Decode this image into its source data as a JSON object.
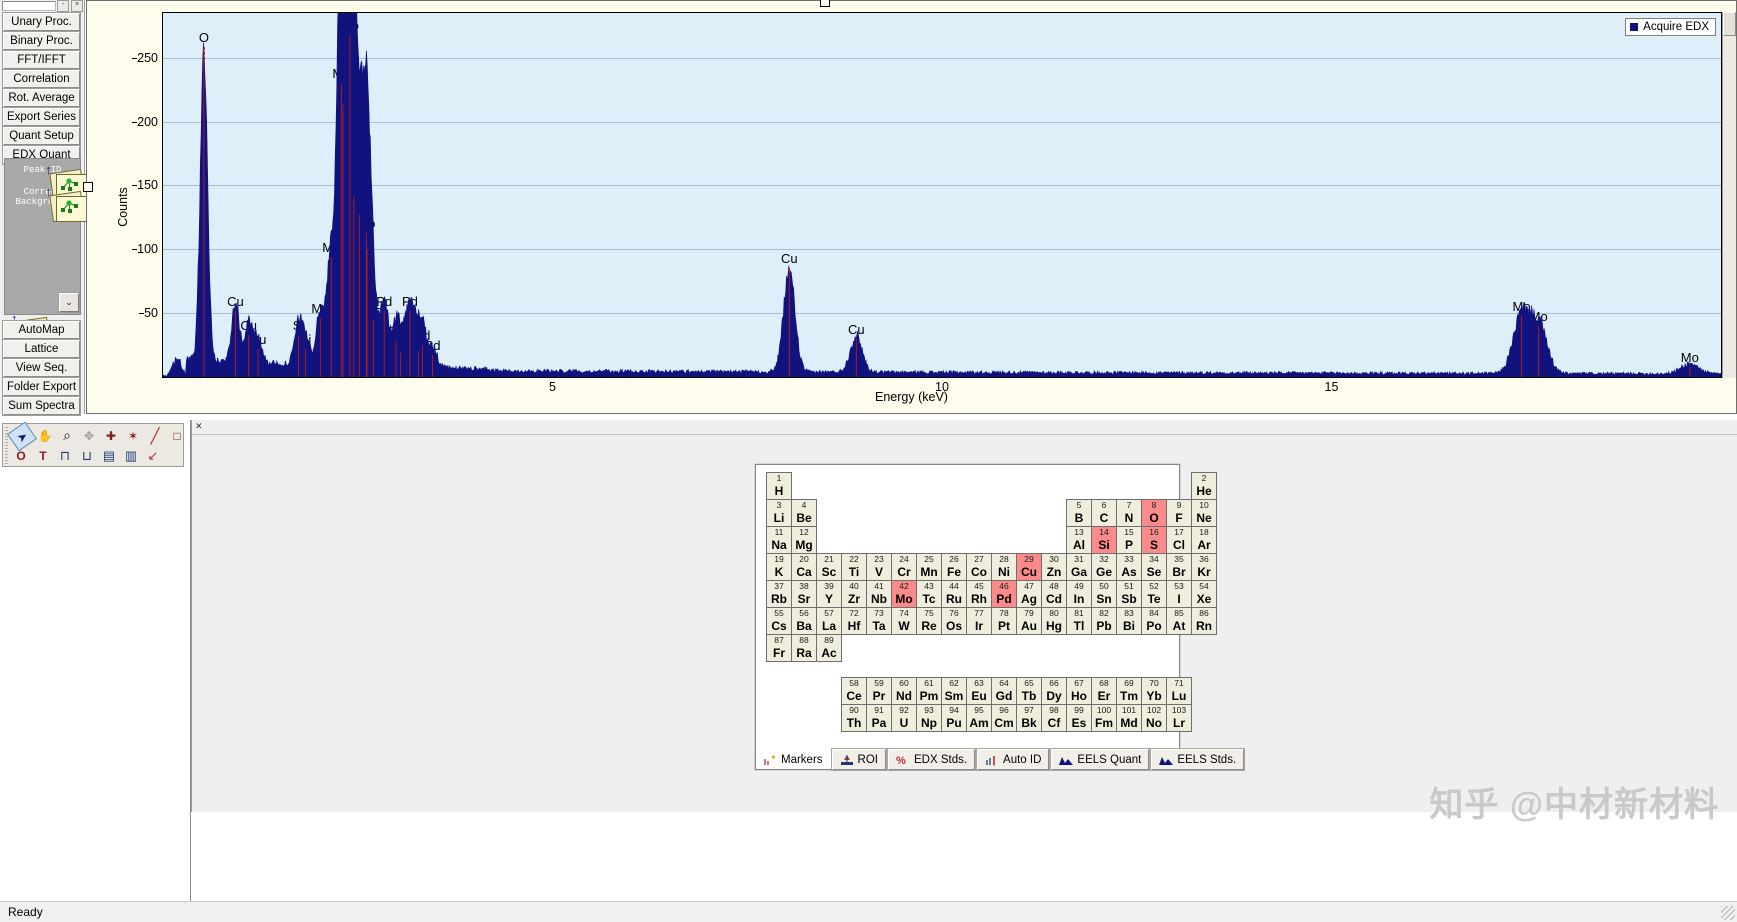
{
  "app": {
    "status_text": "Ready"
  },
  "palette": {
    "title_buttons": [
      "-",
      "×"
    ],
    "buttons_top": [
      {
        "label": "Unary Proc."
      },
      {
        "label": "Binary Proc."
      },
      {
        "label": "FFT/IFFT"
      },
      {
        "label": "Correlation"
      },
      {
        "label": "Rot. Average"
      },
      {
        "label": "Export Series"
      },
      {
        "label": "Quant Setup"
      },
      {
        "label": "EDX Quant"
      }
    ],
    "icon_buttons": [
      {
        "label": "Peak ID",
        "icon": "peak-id-icon"
      },
      {
        "label": "Correct Background",
        "icon": "correct-background-icon"
      }
    ],
    "dropdown_caret": "⌄",
    "buttons_bottom": [
      {
        "label": "AutoMap"
      },
      {
        "label": "Lattice"
      },
      {
        "label": "View Seq."
      },
      {
        "label": "Folder Export"
      },
      {
        "label": "Sum Spectra"
      }
    ]
  },
  "toolbar": {
    "row1": [
      {
        "name": "arrow-select-icon",
        "glyph": "➤"
      },
      {
        "name": "hand-pan-icon",
        "glyph": "✋"
      },
      {
        "name": "magnifier-zoom-icon",
        "glyph": "⌕"
      },
      {
        "name": "move-crosshair-icon",
        "glyph": "✥"
      },
      {
        "name": "marker-cross-icon",
        "glyph": "✚"
      },
      {
        "name": "point-marker-icon",
        "glyph": "✶"
      },
      {
        "name": "line-tool-icon",
        "glyph": "╱"
      },
      {
        "name": "rectangle-tool-icon",
        "glyph": "□"
      }
    ],
    "row2": [
      {
        "name": "oval-tool-icon",
        "glyph": "O"
      },
      {
        "name": "text-tool-icon",
        "glyph": "T"
      },
      {
        "name": "spectrum-picker-icon",
        "glyph": "⊓"
      },
      {
        "name": "spectrum-range-icon",
        "glyph": "⊔"
      },
      {
        "name": "ruler-tool-icon",
        "glyph": "▤"
      },
      {
        "name": "ruler-measure-icon",
        "glyph": "▥"
      },
      {
        "name": "annotation-tool-icon",
        "glyph": "↙"
      }
    ]
  },
  "chart_data": {
    "type": "line",
    "title": "",
    "xlabel": "Energy (keV)",
    "ylabel": "Counts",
    "xlim": [
      0,
      20
    ],
    "ylim": [
      0,
      285
    ],
    "xticks": [
      5,
      10,
      15
    ],
    "yticks": [
      50,
      100,
      150,
      200,
      250
    ],
    "grid": true,
    "legend_position": "top-right",
    "series": [
      {
        "name": "Acquire EDX",
        "color": "#12127e"
      }
    ],
    "peak_markers": [
      {
        "element": "O",
        "energy": 0.525,
        "counts": 258
      },
      {
        "element": "Cu",
        "energy": 0.93,
        "counts": 52
      },
      {
        "element": "Cu",
        "energy": 1.1,
        "counts": 33
      },
      {
        "element": "Cu",
        "energy": 1.22,
        "counts": 22
      },
      {
        "element": "Si",
        "energy": 1.74,
        "counts": 33
      },
      {
        "element": "Si",
        "energy": 1.83,
        "counts": 22
      },
      {
        "element": "Mo",
        "energy": 2.02,
        "counts": 46
      },
      {
        "element": "Mo",
        "energy": 2.16,
        "counts": 94
      },
      {
        "element": "S",
        "energy": 2.31,
        "counts": 214
      },
      {
        "element": "Mo",
        "energy": 2.29,
        "counts": 230
      },
      {
        "element": "Mo",
        "energy": 2.4,
        "counts": 268
      },
      {
        "element": "Pd",
        "energy": 2.45,
        "counts": 141
      },
      {
        "element": "Mo",
        "energy": 2.52,
        "counts": 127
      },
      {
        "element": "Mo",
        "energy": 2.61,
        "counts": 113
      },
      {
        "element": "S",
        "energy": 2.62,
        "counts": 100
      },
      {
        "element": "Mo",
        "energy": 2.7,
        "counts": 45
      },
      {
        "element": "Pd",
        "energy": 2.84,
        "counts": 52
      },
      {
        "element": "Pd",
        "energy": 2.99,
        "counts": 28
      },
      {
        "element": "Pd",
        "energy": 3.17,
        "counts": 52
      },
      {
        "element": "Pd",
        "energy": 3.05,
        "counts": 19
      },
      {
        "element": "Pd",
        "energy": 3.28,
        "counts": 20
      },
      {
        "element": "Pd",
        "energy": 3.33,
        "counts": 25
      },
      {
        "element": "Pd",
        "energy": 3.46,
        "counts": 17
      },
      {
        "element": "Cu",
        "energy": 8.04,
        "counts": 85
      },
      {
        "element": "Cu",
        "energy": 8.9,
        "counts": 30
      },
      {
        "element": "Mo",
        "energy": 17.44,
        "counts": 48
      },
      {
        "element": "Mo",
        "energy": 17.66,
        "counts": 40
      },
      {
        "element": "Mo",
        "energy": 19.6,
        "counts": 8
      }
    ]
  },
  "legend": {
    "label": "Acquire EDX",
    "color": "#12127e"
  },
  "periodic_table": {
    "selected": [
      "O",
      "Si",
      "Cu",
      "Mo",
      "Pd"
    ],
    "rows": [
      [
        {
          "n": "1",
          "s": "H",
          "c": 1
        },
        {
          "n": "2",
          "s": "He",
          "c": 18
        }
      ],
      [
        {
          "n": "3",
          "s": "Li",
          "c": 1
        },
        {
          "n": "4",
          "s": "Be",
          "c": 2
        },
        {
          "n": "5",
          "s": "B",
          "c": 13
        },
        {
          "n": "6",
          "s": "C",
          "c": 14
        },
        {
          "n": "7",
          "s": "N",
          "c": 15
        },
        {
          "n": "8",
          "s": "O",
          "c": 16,
          "hl": true
        },
        {
          "n": "9",
          "s": "F",
          "c": 17
        },
        {
          "n": "10",
          "s": "Ne",
          "c": 18
        }
      ],
      [
        {
          "n": "11",
          "s": "Na",
          "c": 1
        },
        {
          "n": "12",
          "s": "Mg",
          "c": 2
        },
        {
          "n": "13",
          "s": "Al",
          "c": 13
        },
        {
          "n": "14",
          "s": "Si",
          "c": 14,
          "hl": true
        },
        {
          "n": "15",
          "s": "P",
          "c": 15
        },
        {
          "n": "16",
          "s": "S",
          "c": 16,
          "hl": true
        },
        {
          "n": "17",
          "s": "Cl",
          "c": 17
        },
        {
          "n": "18",
          "s": "Ar",
          "c": 18
        }
      ],
      [
        {
          "n": "19",
          "s": "K",
          "c": 1
        },
        {
          "n": "20",
          "s": "Ca",
          "c": 2
        },
        {
          "n": "21",
          "s": "Sc",
          "c": 3
        },
        {
          "n": "22",
          "s": "Ti",
          "c": 4
        },
        {
          "n": "23",
          "s": "V",
          "c": 5
        },
        {
          "n": "24",
          "s": "Cr",
          "c": 6
        },
        {
          "n": "25",
          "s": "Mn",
          "c": 7
        },
        {
          "n": "26",
          "s": "Fe",
          "c": 8
        },
        {
          "n": "27",
          "s": "Co",
          "c": 9
        },
        {
          "n": "28",
          "s": "Ni",
          "c": 10
        },
        {
          "n": "29",
          "s": "Cu",
          "c": 11,
          "hl": true
        },
        {
          "n": "30",
          "s": "Zn",
          "c": 12
        },
        {
          "n": "31",
          "s": "Ga",
          "c": 13
        },
        {
          "n": "32",
          "s": "Ge",
          "c": 14
        },
        {
          "n": "33",
          "s": "As",
          "c": 15
        },
        {
          "n": "34",
          "s": "Se",
          "c": 16
        },
        {
          "n": "35",
          "s": "Br",
          "c": 17
        },
        {
          "n": "36",
          "s": "Kr",
          "c": 18
        }
      ],
      [
        {
          "n": "37",
          "s": "Rb",
          "c": 1
        },
        {
          "n": "38",
          "s": "Sr",
          "c": 2
        },
        {
          "n": "39",
          "s": "Y",
          "c": 3
        },
        {
          "n": "40",
          "s": "Zr",
          "c": 4
        },
        {
          "n": "41",
          "s": "Nb",
          "c": 5
        },
        {
          "n": "42",
          "s": "Mo",
          "c": 6,
          "hl": true
        },
        {
          "n": "43",
          "s": "Tc",
          "c": 7
        },
        {
          "n": "44",
          "s": "Ru",
          "c": 8
        },
        {
          "n": "45",
          "s": "Rh",
          "c": 9
        },
        {
          "n": "46",
          "s": "Pd",
          "c": 10,
          "hl": true
        },
        {
          "n": "47",
          "s": "Ag",
          "c": 11
        },
        {
          "n": "48",
          "s": "Cd",
          "c": 12
        },
        {
          "n": "49",
          "s": "In",
          "c": 13
        },
        {
          "n": "50",
          "s": "Sn",
          "c": 14
        },
        {
          "n": "51",
          "s": "Sb",
          "c": 15
        },
        {
          "n": "52",
          "s": "Te",
          "c": 16
        },
        {
          "n": "53",
          "s": "I",
          "c": 17
        },
        {
          "n": "54",
          "s": "Xe",
          "c": 18
        }
      ],
      [
        {
          "n": "55",
          "s": "Cs",
          "c": 1
        },
        {
          "n": "56",
          "s": "Ba",
          "c": 2
        },
        {
          "n": "57",
          "s": "La",
          "c": 3
        },
        {
          "n": "72",
          "s": "Hf",
          "c": 4
        },
        {
          "n": "73",
          "s": "Ta",
          "c": 5
        },
        {
          "n": "74",
          "s": "W",
          "c": 6
        },
        {
          "n": "75",
          "s": "Re",
          "c": 7
        },
        {
          "n": "76",
          "s": "Os",
          "c": 8
        },
        {
          "n": "77",
          "s": "Ir",
          "c": 9
        },
        {
          "n": "78",
          "s": "Pt",
          "c": 10
        },
        {
          "n": "79",
          "s": "Au",
          "c": 11
        },
        {
          "n": "80",
          "s": "Hg",
          "c": 12
        },
        {
          "n": "81",
          "s": "Tl",
          "c": 13
        },
        {
          "n": "82",
          "s": "Pb",
          "c": 14
        },
        {
          "n": "83",
          "s": "Bi",
          "c": 15
        },
        {
          "n": "84",
          "s": "Po",
          "c": 16
        },
        {
          "n": "85",
          "s": "At",
          "c": 17
        },
        {
          "n": "86",
          "s": "Rn",
          "c": 18
        }
      ],
      [
        {
          "n": "87",
          "s": "Fr",
          "c": 1
        },
        {
          "n": "88",
          "s": "Ra",
          "c": 2
        },
        {
          "n": "89",
          "s": "Ac",
          "c": 3
        }
      ]
    ],
    "lanthanides": [
      {
        "n": "58",
        "s": "Ce"
      },
      {
        "n": "59",
        "s": "Pr"
      },
      {
        "n": "60",
        "s": "Nd"
      },
      {
        "n": "61",
        "s": "Pm"
      },
      {
        "n": "62",
        "s": "Sm"
      },
      {
        "n": "63",
        "s": "Eu"
      },
      {
        "n": "64",
        "s": "Gd"
      },
      {
        "n": "65",
        "s": "Tb"
      },
      {
        "n": "66",
        "s": "Dy"
      },
      {
        "n": "67",
        "s": "Ho"
      },
      {
        "n": "68",
        "s": "Er"
      },
      {
        "n": "69",
        "s": "Tm"
      },
      {
        "n": "70",
        "s": "Yb"
      },
      {
        "n": "71",
        "s": "Lu"
      }
    ],
    "actinides": [
      {
        "n": "90",
        "s": "Th"
      },
      {
        "n": "91",
        "s": "Pa"
      },
      {
        "n": "92",
        "s": "U"
      },
      {
        "n": "93",
        "s": "Np"
      },
      {
        "n": "94",
        "s": "Pu"
      },
      {
        "n": "95",
        "s": "Am"
      },
      {
        "n": "96",
        "s": "Cm"
      },
      {
        "n": "97",
        "s": "Bk"
      },
      {
        "n": "98",
        "s": "Cf"
      },
      {
        "n": "99",
        "s": "Es"
      },
      {
        "n": "100",
        "s": "Fm"
      },
      {
        "n": "101",
        "s": "Md"
      },
      {
        "n": "102",
        "s": "No"
      },
      {
        "n": "103",
        "s": "Lr"
      }
    ],
    "tabs": [
      {
        "label": "Markers",
        "icon": "markers-icon",
        "flat": true
      },
      {
        "label": "ROI",
        "icon": "roi-icon",
        "flat": false
      },
      {
        "label": "EDX Stds.",
        "icon": "percent-icon",
        "flat": false
      },
      {
        "label": "Auto ID",
        "icon": "auto-id-icon",
        "flat": false
      },
      {
        "label": "EELS Quant",
        "icon": "eels-icon",
        "flat": false
      },
      {
        "label": "EELS Stds.",
        "icon": "eels-icon",
        "flat": false
      }
    ]
  },
  "watermark": {
    "text": "知乎 @中材新材料"
  }
}
